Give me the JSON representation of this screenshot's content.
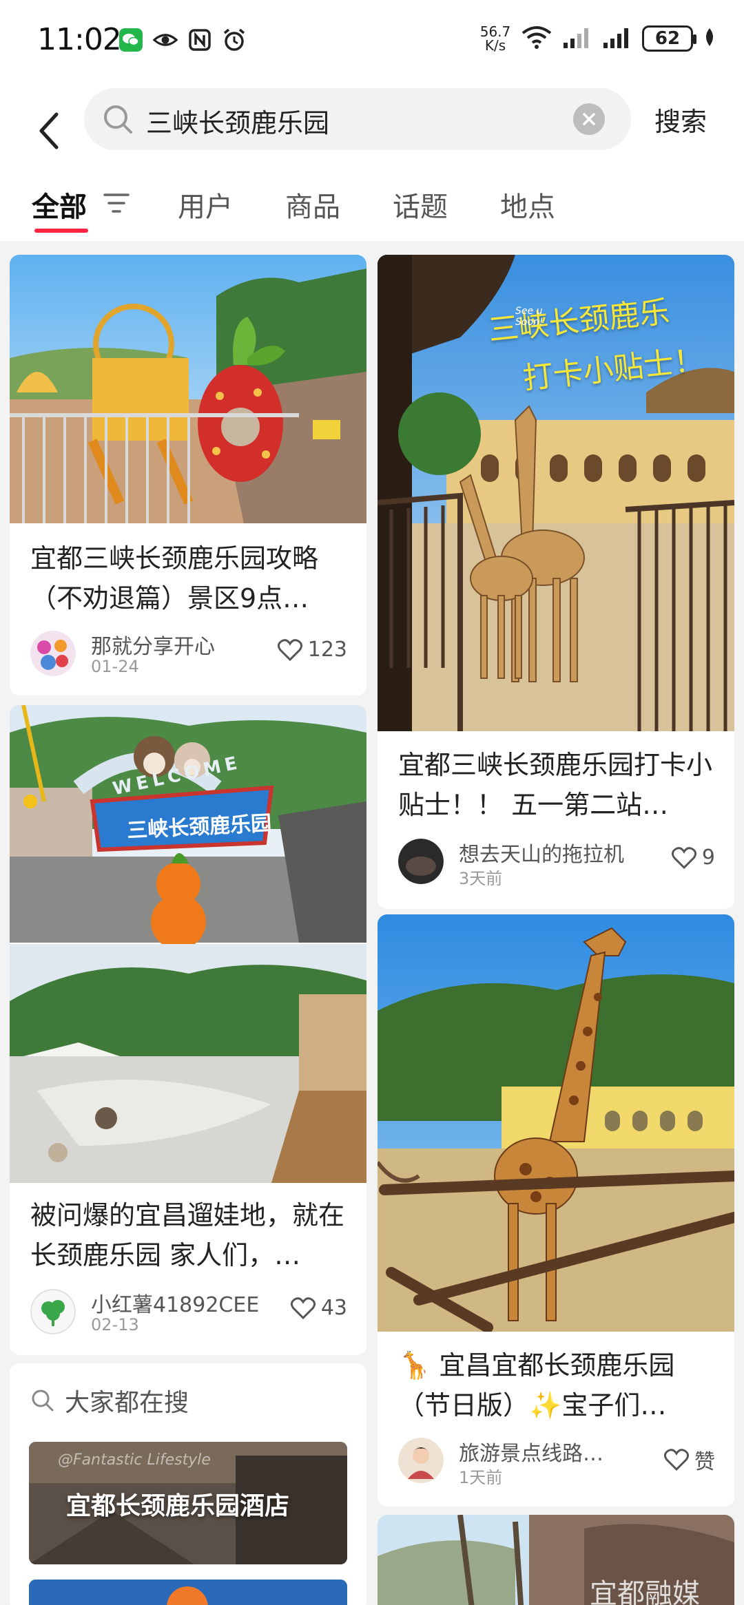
{
  "status_bar": {
    "time": "11:02",
    "net_speed_value": "56.7",
    "net_speed_unit": "K/s",
    "battery": "62"
  },
  "search": {
    "query": "三峡长颈鹿乐园",
    "submit_label": "搜索"
  },
  "tabs": [
    {
      "label": "全部",
      "active": true
    },
    {
      "label": "用户"
    },
    {
      "label": "商品"
    },
    {
      "label": "话题"
    },
    {
      "label": "地点"
    }
  ],
  "posts": [
    {
      "title": "宜都三峡长颈鹿乐园攻略（不劝退篇）景区9点…",
      "author": "那就分享开心",
      "date": "01-24",
      "likes": "123",
      "image": "amusement-park-playground"
    },
    {
      "title": "宜都三峡长颈鹿乐园打卡小贴士！！ 五一第二站…",
      "author": "想去天山的拖拉机",
      "date": "3天前",
      "likes": "9",
      "image": "giraffes-feeding-pavilion",
      "overlay_line1": "三峡长颈鹿乐",
      "overlay_line2": "打卡小贴士！",
      "overlay_small": "See u Soon!"
    },
    {
      "title": "被问爆的宜昌遛娃地，就在长颈鹿乐园 家人们，…",
      "author": "小红薯41892CEE",
      "date": "02-13",
      "likes": "43",
      "image": "park-entrance-sign",
      "sign_text": "三峡长颈鹿乐园",
      "sign_arc": "WELCOME"
    },
    {
      "title": "🦒 宜昌宜都长颈鹿乐园（节日版）✨宝子们…",
      "author": "旅游景点线路…",
      "date": "1天前",
      "likes": "赞",
      "image": "giraffe-closeup"
    }
  ],
  "trending": {
    "header": "大家都在搜",
    "items": [
      {
        "label": "宜都长颈鹿乐园酒店",
        "watermark": "@Fantastic Lifestyle"
      }
    ]
  },
  "corner_watermark": "宜都融媒",
  "colors": {
    "accent": "#ff2442",
    "background": "#f3f3f3"
  }
}
